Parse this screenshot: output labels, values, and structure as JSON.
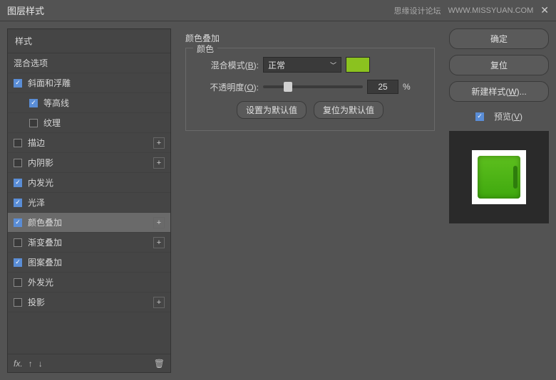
{
  "titlebar": {
    "title": "图层样式",
    "brand": "思缘设计论坛",
    "brand_url": "WWW.MISSYUAN.COM"
  },
  "left": {
    "header": "样式",
    "blend_options": "混合选项",
    "items": [
      {
        "label": "斜面和浮雕",
        "checked": true,
        "has_plus": false
      },
      {
        "label": "等高线",
        "checked": true,
        "sub": true
      },
      {
        "label": "纹理",
        "checked": false,
        "sub": true
      },
      {
        "label": "描边",
        "checked": false,
        "has_plus": true
      },
      {
        "label": "内阴影",
        "checked": false,
        "has_plus": true
      },
      {
        "label": "内发光",
        "checked": true
      },
      {
        "label": "光泽",
        "checked": true
      },
      {
        "label": "颜色叠加",
        "checked": true,
        "has_plus": true,
        "selected": true
      },
      {
        "label": "渐变叠加",
        "checked": false,
        "has_plus": true
      },
      {
        "label": "图案叠加",
        "checked": true
      },
      {
        "label": "外发光",
        "checked": false
      },
      {
        "label": "投影",
        "checked": false,
        "has_plus": true
      }
    ],
    "fx": "fx"
  },
  "center": {
    "title": "颜色叠加",
    "group": "颜色",
    "blend_mode_label_pre": "混合模式(",
    "blend_mode_label_key": "B",
    "blend_mode_label_post": "):",
    "blend_mode_value": "正常",
    "opacity_label_pre": "不透明度(",
    "opacity_label_key": "O",
    "opacity_label_post": "):",
    "opacity_value": "25",
    "pct": "%",
    "set_default": "设置为默认值",
    "reset_default": "复位为默认值",
    "color": "#8bc21f"
  },
  "right": {
    "ok": "确定",
    "reset": "复位",
    "new_style_pre": "新建样式(",
    "new_style_key": "W",
    "new_style_post": ")...",
    "preview_pre": "预览(",
    "preview_key": "V",
    "preview_post": ")"
  }
}
